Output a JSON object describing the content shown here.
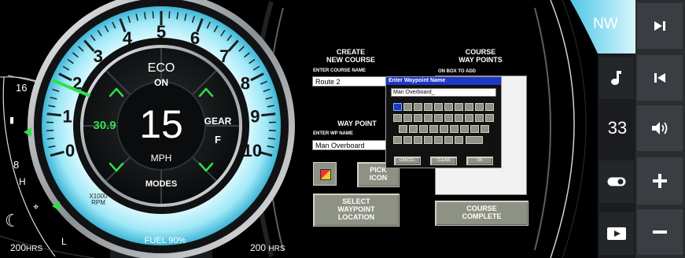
{
  "gauge": {
    "dial_numbers": [
      "0",
      "1",
      "2",
      "3",
      "4",
      "5",
      "6",
      "7",
      "8",
      "9",
      "10"
    ],
    "rpm_unit": "X1000\nRPM",
    "rpm_unit_line1": "X1000",
    "rpm_unit_line2": "RPM",
    "speed_value": "15",
    "speed_unit": "MPH",
    "eco_label": "ECO",
    "eco_state": "ON",
    "gear_label": "GEAR",
    "gear_value": "F",
    "modes_label": "MODES",
    "trim_value": "30.9",
    "fuel_label": "FUEL 90%",
    "engine_hours_left_value": "200",
    "engine_hours_left_unit": "HRS",
    "engine_hours_right_value": "200",
    "engine_hours_right_unit": "HRS",
    "rpm_needle_value": 1.8
  },
  "left_scale": {
    "top_value": "16",
    "low_value": "8",
    "high_marker": "H",
    "low_marker": "L"
  },
  "course_panel": {
    "create_title_line1": "CREATE",
    "create_title_line2": "NEW COURSE",
    "course_waypoints_line1": "COURSE",
    "course_waypoints_line2": "WAY POINTS",
    "enter_course_name_label": "ENTER COURSE NAME",
    "on_box_to_add_label": "ON BOX TO ADD",
    "course_name_value": "Route 2",
    "waypoint_title": "WAY POINT",
    "enter_wp_name_label": "ENTER WP NAME",
    "wp_name_value": "Man Overboard",
    "pick_icon_line1": "PICK",
    "pick_icon_line2": "ICON",
    "select_waypoint_line1": "SELECT",
    "select_waypoint_line2": "WAYPOINT",
    "select_waypoint_line3": "LOCATION",
    "course_complete_line1": "COURSE",
    "course_complete_line2": "COMPLETE"
  },
  "dialog": {
    "title": "Enter Waypoint Name",
    "input_value": "Man Overboard_",
    "cancel": "CANCEL",
    "clear": "CLEAR",
    "ok": "OK"
  },
  "right_panel": {
    "heading": "NW",
    "volume_value": "33",
    "icons": [
      "skip-forward-icon",
      "music-note-icon",
      "skip-back-icon",
      "speaker-icon",
      "toggle-icon",
      "plus-icon",
      "play-icon",
      "minus-icon"
    ]
  },
  "colors": {
    "accent_blue": "#8fe3f5",
    "green": "#2ee04a",
    "grey_button": "#8e9284",
    "dialog_title_blue": "#1d37c8"
  }
}
